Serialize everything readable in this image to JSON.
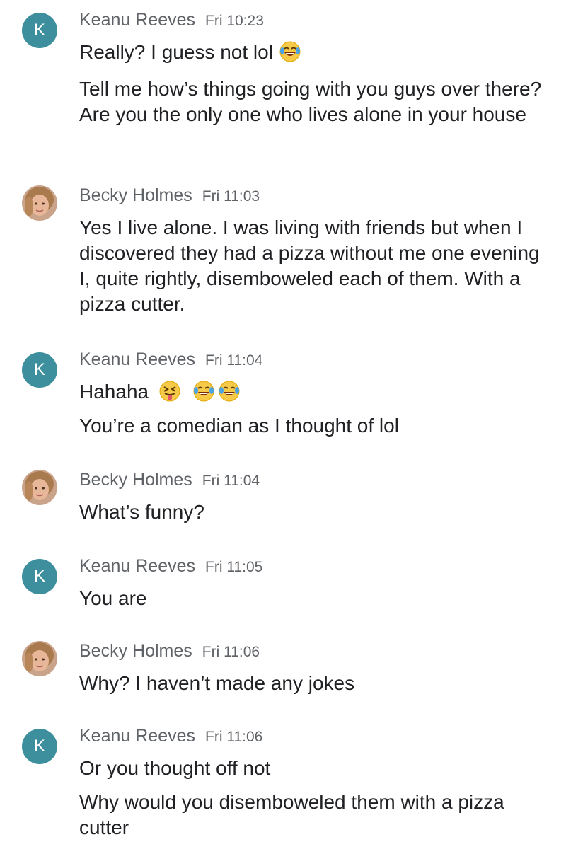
{
  "messages": [
    {
      "avatar_initial": "K",
      "sender": "Keanu Reeves",
      "time": "Fri 10:23",
      "lines": [
        {
          "text": "Really? I guess not lol",
          "emojis": [
            "face-with-tears-of-joy-icon"
          ]
        },
        {
          "text": "Tell me how’s things going with you guys over there? Are you the only one who lives alone in your house"
        }
      ]
    },
    {
      "avatar_initial": "",
      "sender": "Becky Holmes",
      "time": "Fri 11:03",
      "lines": [
        {
          "text": "Yes I live alone. I was living with friends but when I discovered they had a pizza without me one evening I, quite rightly, disemboweled each of them. With a pizza cutter."
        }
      ]
    },
    {
      "avatar_initial": "K",
      "sender": "Keanu Reeves",
      "time": "Fri 11:04",
      "lines": [
        {
          "text": "Hahaha",
          "emojis": [
            "squinting-face-with-tongue-icon",
            "face-with-tears-of-joy-icon",
            "face-with-tears-of-joy-icon"
          ]
        },
        {
          "text": "You’re a comedian as I thought of lol"
        }
      ]
    },
    {
      "avatar_initial": "",
      "sender": "Becky Holmes",
      "time": "Fri 11:04",
      "lines": [
        {
          "text": "What’s funny?"
        }
      ]
    },
    {
      "avatar_initial": "K",
      "sender": "Keanu Reeves",
      "time": "Fri 11:05",
      "lines": [
        {
          "text": "You are"
        }
      ]
    },
    {
      "avatar_initial": "",
      "sender": "Becky Holmes",
      "time": "Fri 11:06",
      "lines": [
        {
          "text": "Why? I haven’t made any jokes"
        }
      ]
    },
    {
      "avatar_initial": "K",
      "sender": "Keanu Reeves",
      "time": "Fri 11:06",
      "lines": [
        {
          "text": "Or you thought off not"
        },
        {
          "text": "Why would you disemboweled them with a pizza cutter"
        }
      ]
    }
  ],
  "colors": {
    "avatar_bg": "#3d8f9e",
    "sender_text": "#5f6368",
    "body_text": "#202124",
    "background": "#ffffff"
  }
}
